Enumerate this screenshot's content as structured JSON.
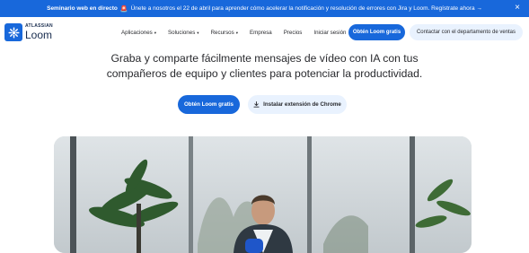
{
  "banner": {
    "bold": "Seminario web en directo",
    "emoji": "🚨",
    "message": "Únete a nosotros el 22 de abril para aprender cómo acelerar la notificación y resolución de errores con Jira y Loom. Regístrate ahora →",
    "close": "×"
  },
  "logo": {
    "top": "ATLASSIAN",
    "bottom": "Loom"
  },
  "nav": {
    "items": [
      {
        "label": "Aplicaciones",
        "caret": "▾"
      },
      {
        "label": "Soluciones",
        "caret": "▾"
      },
      {
        "label": "Recursos",
        "caret": "▾"
      },
      {
        "label": "Empresa"
      },
      {
        "label": "Precios"
      },
      {
        "label": "Iniciar sesión"
      }
    ],
    "primary_button": "Obtén Loom gratis",
    "secondary_button": "Contactar con el departamento de ventas"
  },
  "hero": {
    "headline_line1": "Graba y comparte fácilmente mensajes de vídeo con IA con tus",
    "headline_line2": "compañeros de equipo y clientes para potenciar la productividad.",
    "cta_primary": "Obtén Loom gratis",
    "cta_secondary": "Instalar extensión de Chrome"
  },
  "colors": {
    "brand_blue": "#1868db",
    "light_blue": "#e9f2fe",
    "text": "#292a2e"
  }
}
